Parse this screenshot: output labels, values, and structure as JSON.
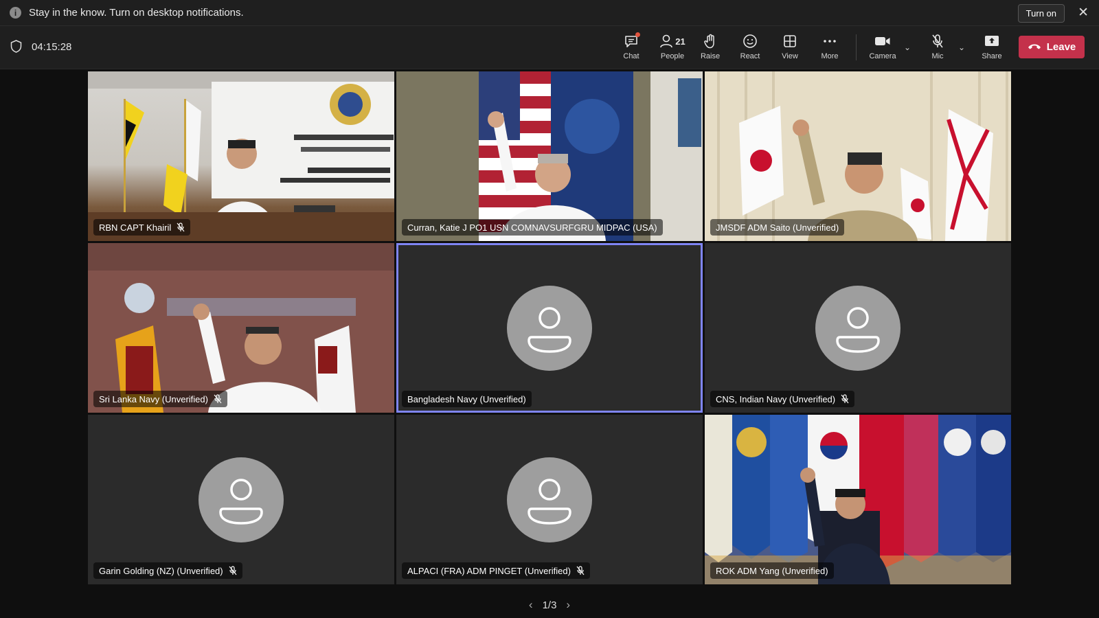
{
  "banner": {
    "message": "Stay in the know. Turn on desktop notifications.",
    "button": "Turn on",
    "info_icon": "info-icon",
    "close_icon": "close-icon"
  },
  "toolbar": {
    "timer": "04:15:28",
    "chat": "Chat",
    "people": "People",
    "people_count": "21",
    "raise": "Raise",
    "react": "React",
    "view": "View",
    "more": "More",
    "camera": "Camera",
    "mic": "Mic",
    "share": "Share",
    "leave": "Leave",
    "leave_color": "#c4314b"
  },
  "tiles": [
    {
      "name": "RBN CAPT Khairil",
      "muted": true,
      "video": true
    },
    {
      "name": "Curran, Katie J PO1 USN COMNAVSURFGRU MIDPAC (USA)",
      "muted": false,
      "video": true
    },
    {
      "name": "JMSDF ADM Saito (Unverified)",
      "muted": false,
      "video": true
    },
    {
      "name": "Sri Lanka Navy (Unverified)",
      "muted": true,
      "video": true
    },
    {
      "name": "Bangladesh Navy (Unverified)",
      "muted": false,
      "video": false,
      "selected": true
    },
    {
      "name": "CNS, Indian Navy (Unverified)",
      "muted": true,
      "video": false
    },
    {
      "name": "Garin Golding (NZ) (Unverified)",
      "muted": true,
      "video": false
    },
    {
      "name": "ALPACI (FRA) ADM PINGET (Unverified)",
      "muted": true,
      "video": false
    },
    {
      "name": "ROK ADM Yang (Unverified)",
      "muted": false,
      "video": true
    }
  ],
  "pagination": {
    "label": "1/3"
  },
  "colors": {
    "selected_border": "#7f85f5",
    "background": "#0f0f0f",
    "toolbar": "#1f1f1f"
  }
}
